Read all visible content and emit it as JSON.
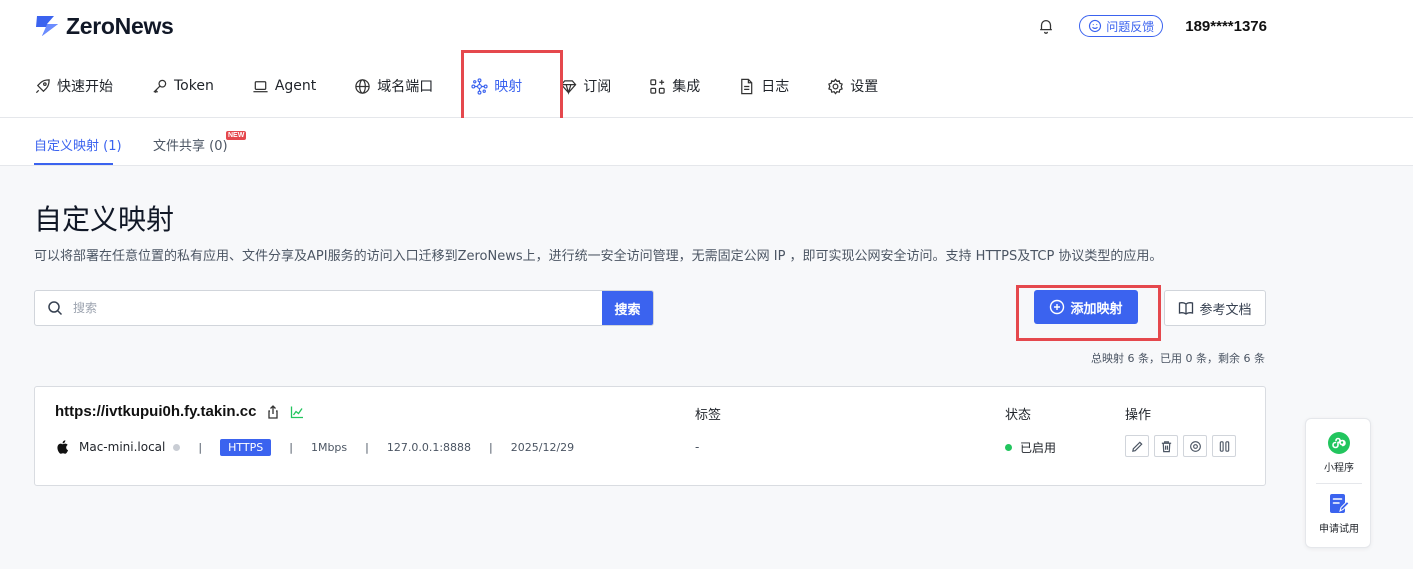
{
  "header": {
    "logo_text": "ZeroNews",
    "feedback_label": "问题反馈",
    "user": "189****1376"
  },
  "nav": {
    "items": [
      {
        "label": "快速开始",
        "icon": "rocket-icon"
      },
      {
        "label": "Token",
        "icon": "key-icon"
      },
      {
        "label": "Agent",
        "icon": "laptop-icon"
      },
      {
        "label": "域名端口",
        "icon": "globe-icon"
      },
      {
        "label": "映射",
        "icon": "network-icon",
        "active": true
      },
      {
        "label": "订阅",
        "icon": "diamond-icon"
      },
      {
        "label": "集成",
        "icon": "grid-plus-icon"
      },
      {
        "label": "日志",
        "icon": "document-icon"
      },
      {
        "label": "设置",
        "icon": "gear-icon"
      }
    ]
  },
  "subtabs": {
    "custom": "自定义映射 (1)",
    "files": "文件共享 (0)",
    "new_badge": "NEW"
  },
  "page": {
    "title": "自定义映射",
    "description": "可以将部署在任意位置的私有应用、文件分享及API服务的访问入口迁移到ZeroNews上，进行统一安全访问管理，无需固定公网 IP ，即可实现公网安全访问。支持 HTTPS及TCP 协议类型的应用。"
  },
  "search": {
    "placeholder": "搜索",
    "button": "搜索"
  },
  "toolbar": {
    "add_label": "添加映射",
    "docs_label": "参考文档",
    "quota": "总映射 6 条，已用 0 条，剩余 6 条"
  },
  "columns": {
    "tags": "标签",
    "status": "状态",
    "actions": "操作"
  },
  "mapping": {
    "url": "https://ivtkupui0h.fy.takin.cc",
    "host": "Mac-mini.local",
    "protocol": "HTTPS",
    "bandwidth": "1Mbps",
    "target": "127.0.0.1:8888",
    "date": "2025/12/29",
    "tags": "-",
    "status": "已启用"
  },
  "float": {
    "miniprogram": "小程序",
    "trial": "申请试用"
  },
  "colors": {
    "accent": "#3b63ef",
    "highlight": "#e5484d",
    "status_ok": "#22c55e"
  }
}
